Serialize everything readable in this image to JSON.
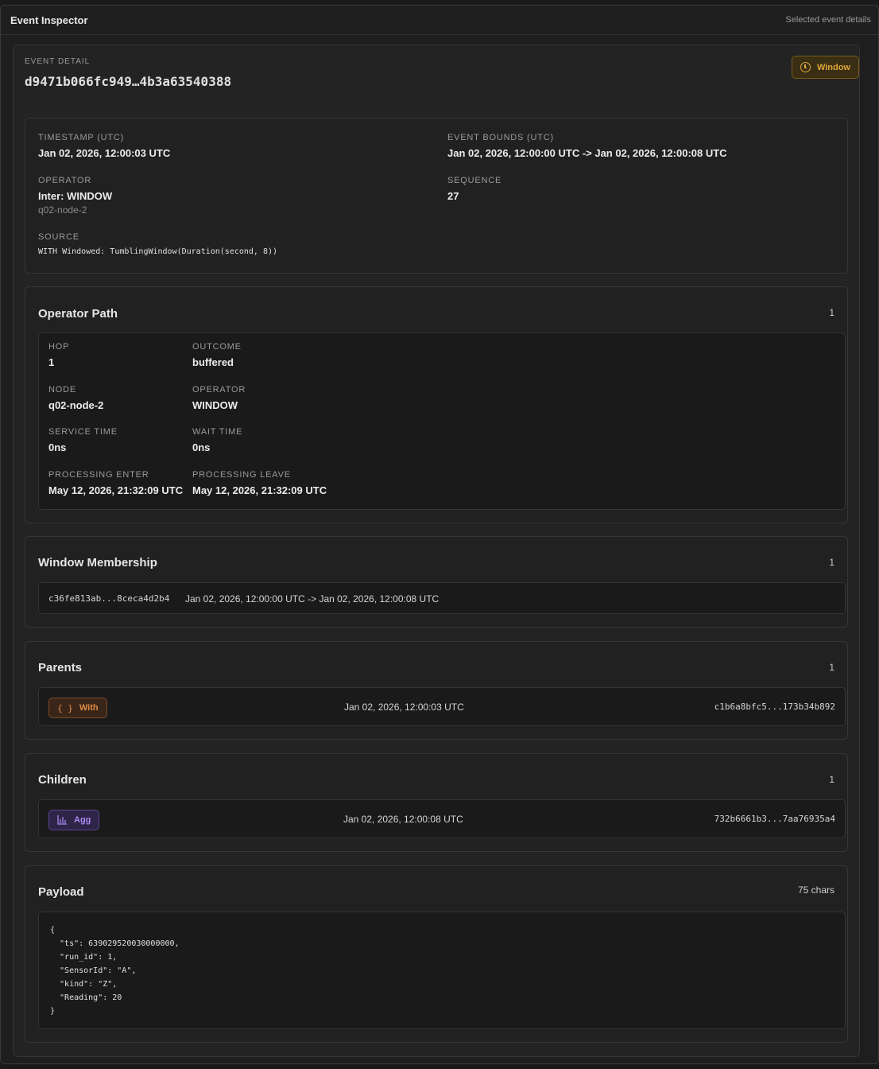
{
  "header": {
    "title": "Event Inspector",
    "subtitle": "Selected event details"
  },
  "event": {
    "eyebrow": "EVENT DETAIL",
    "id": "d9471b066fc949…4b3a63540388",
    "badge": "Window",
    "badge_icon": "clock-icon",
    "badge_color": "#e0a83a"
  },
  "summary": {
    "timestamp_label": "TIMESTAMP (UTC)",
    "timestamp": "Jan 02, 2026, 12:00:03 UTC",
    "bounds_label": "EVENT BOUNDS (UTC)",
    "bounds": "Jan 02, 2026, 12:00:00 UTC -> Jan 02, 2026, 12:00:08 UTC",
    "operator_label": "OPERATOR",
    "operator": "Inter: WINDOW",
    "operator_node": "q02-node-2",
    "sequence_label": "SEQUENCE",
    "sequence": "27",
    "source_label": "SOURCE",
    "source": "WITH Windowed: TumblingWindow(Duration(second, 8))"
  },
  "operator_path": {
    "title": "Operator Path",
    "count": "1",
    "hop_label": "HOP",
    "hop": "1",
    "outcome_label": "OUTCOME",
    "outcome": "buffered",
    "node_label": "NODE",
    "node": "q02-node-2",
    "operator_label": "OPERATOR",
    "operator": "WINDOW",
    "service_label": "SERVICE TIME",
    "service": "0ns",
    "wait_label": "WAIT TIME",
    "wait": "0ns",
    "enter_label": "PROCESSING ENTER",
    "enter": "May 12, 2026, 21:32:09 UTC",
    "leave_label": "PROCESSING LEAVE",
    "leave": "May 12, 2026, 21:32:09 UTC"
  },
  "window_membership": {
    "title": "Window Membership",
    "count": "1",
    "id": "c36fe813ab...8ceca4d2b4",
    "range": "Jan 02, 2026, 12:00:00 UTC -> Jan 02, 2026, 12:00:08 UTC"
  },
  "parents": {
    "title": "Parents",
    "count": "1",
    "chip_label": "With",
    "chip_icon": "braces-icon",
    "time": "Jan 02, 2026, 12:00:03 UTC",
    "id": "c1b6a8bfc5...173b34b892"
  },
  "children": {
    "title": "Children",
    "count": "1",
    "chip_label": "Agg",
    "chip_icon": "bar-chart-icon",
    "time": "Jan 02, 2026, 12:00:08 UTC",
    "id": "732b6661b3...7aa76935a4"
  },
  "payload": {
    "title": "Payload",
    "count": "75 chars",
    "content": "{\n  \"ts\": 639029520030000000,\n  \"run_id\": 1,\n  \"SensorId\": \"A\",\n  \"kind\": \"Z\",\n  \"Reading\": 20\n}"
  }
}
